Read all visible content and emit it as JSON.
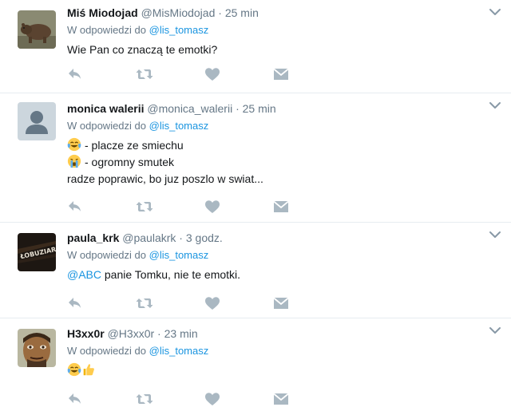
{
  "tweets": [
    {
      "name": "Miś Miodojad",
      "handle": "@MisMiodojad",
      "separator": "·",
      "time": "25 min",
      "replying_prefix": "W odpowiedzi do",
      "replying_to": "@lis_tomasz",
      "lines": [
        "Wie Pan co znaczą te emotki?"
      ],
      "avatar": "bear-photo"
    },
    {
      "name": "monica walerii",
      "handle": "@monica_walerii",
      "separator": "·",
      "time": "25 min",
      "replying_prefix": "W odpowiedzi do",
      "replying_to": "@lis_tomasz",
      "lines": [
        "- placze ze smiechu",
        "- ogromny smutek",
        "radze poprawic, bo juz poszlo w swiat..."
      ],
      "avatar": "default-avatar"
    },
    {
      "name": "paula_krk",
      "handle": "@paulakrk",
      "separator": "·",
      "time": "3 godz.",
      "replying_prefix": "W odpowiedzi do",
      "replying_to": "@lis_tomasz",
      "mention": "@ABC",
      "lines": [
        " panie Tomku, nie te emotki."
      ],
      "avatar": "lobuziara-image"
    },
    {
      "name": "H3xx0r",
      "handle": "@H3xx0r",
      "separator": "·",
      "time": "23 min",
      "replying_prefix": "W odpowiedzi do",
      "replying_to": "@lis_tomasz",
      "lines": [],
      "avatar": "face-photo"
    }
  ],
  "avatar_texts": {
    "lobuziara": "ŁOBUZIARA"
  },
  "icons": [
    "reply-icon",
    "retweet-icon",
    "like-icon",
    "direct-message-icon",
    "chevron-down-icon",
    "tears-of-joy-emoji",
    "crying-emoji",
    "thumbs-up-emoji"
  ],
  "colors": {
    "link": "#1b95e0",
    "muted": "#657786",
    "icon": "#aab8c2",
    "divider": "#e6ecf0"
  }
}
